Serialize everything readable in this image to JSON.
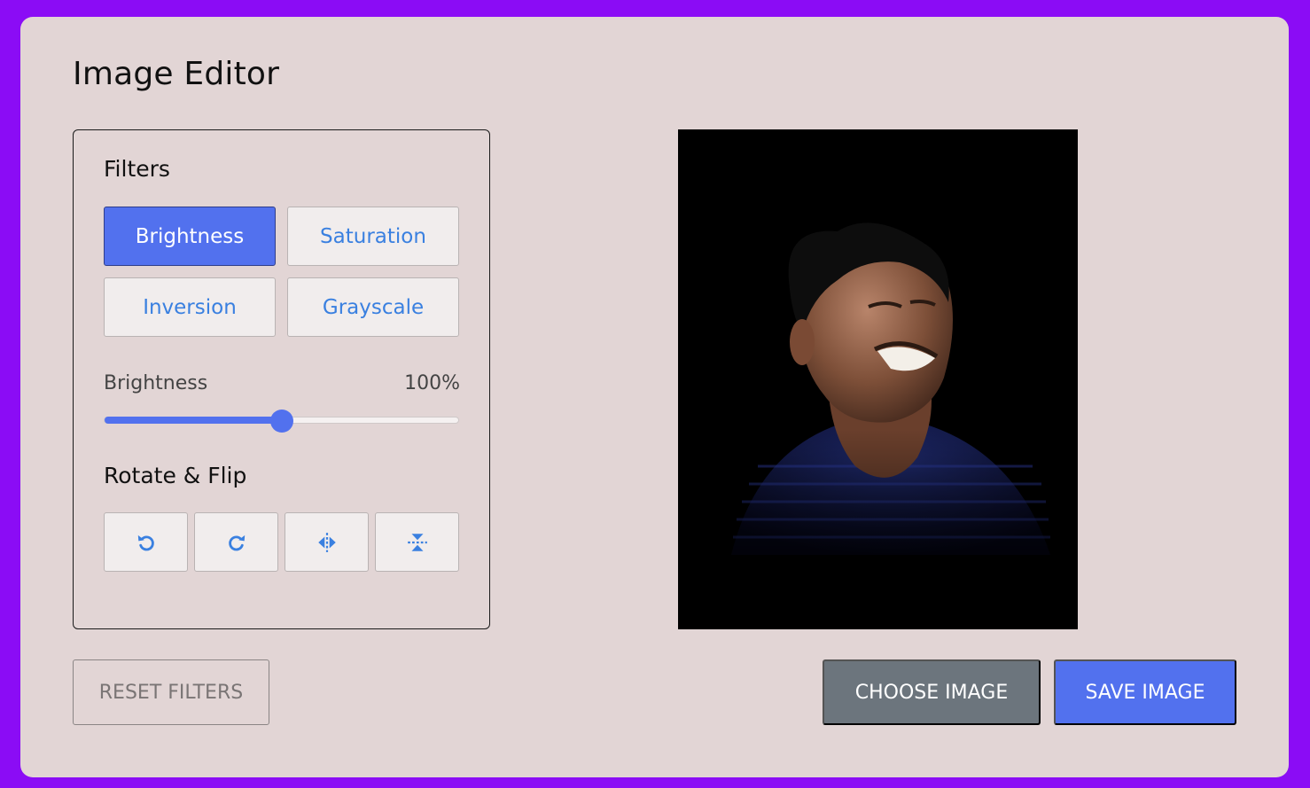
{
  "app": {
    "title": "Image Editor"
  },
  "filters": {
    "heading": "Filters",
    "buttons": [
      {
        "label": "Brightness",
        "active": true
      },
      {
        "label": "Saturation",
        "active": false
      },
      {
        "label": "Inversion",
        "active": false
      },
      {
        "label": "Grayscale",
        "active": false
      }
    ]
  },
  "slider": {
    "label": "Brightness",
    "value_text": "100%",
    "fraction": 0.5
  },
  "rotate_flip": {
    "heading": "Rotate & Flip",
    "buttons": [
      {
        "icon": "rotate-left-icon"
      },
      {
        "icon": "rotate-right-icon"
      },
      {
        "icon": "flip-horizontal-icon"
      },
      {
        "icon": "flip-vertical-icon"
      }
    ]
  },
  "actions": {
    "reset_label": "RESET FILTERS",
    "choose_label": "CHOOSE IMAGE",
    "save_label": "SAVE IMAGE"
  },
  "colors": {
    "page_bg": "#8b0cf5",
    "card_bg": "#e2d5d5",
    "accent": "#5271ee",
    "icon_blue": "#3a80e0",
    "secondary": "#6c757d"
  }
}
